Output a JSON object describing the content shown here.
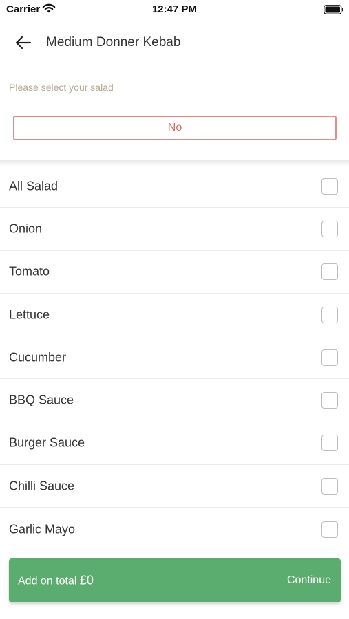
{
  "status_bar": {
    "carrier": "Carrier",
    "time": "12:47 PM"
  },
  "header": {
    "title": "Medium Donner Kebab"
  },
  "prompt": "Please select your salad",
  "no_button_label": "No",
  "options": [
    {
      "label": "All Salad",
      "checked": false
    },
    {
      "label": "Onion",
      "checked": false
    },
    {
      "label": "Tomato",
      "checked": false
    },
    {
      "label": "Lettuce",
      "checked": false
    },
    {
      "label": "Cucumber",
      "checked": false
    },
    {
      "label": "BBQ Sauce",
      "checked": false
    },
    {
      "label": "Burger Sauce",
      "checked": false
    },
    {
      "label": "Chilli Sauce",
      "checked": false
    },
    {
      "label": "Garlic Mayo",
      "checked": false
    }
  ],
  "footer": {
    "total_prefix": "Add on total ",
    "total_value": "£0",
    "continue_label": "Continue"
  },
  "colors": {
    "accent_red": "#e0645c",
    "prompt_text": "#b5a98e",
    "footer_green": "#5aad6e"
  },
  "icons": {
    "back": "arrow-left-icon",
    "wifi": "wifi-icon",
    "battery": "battery-icon"
  }
}
